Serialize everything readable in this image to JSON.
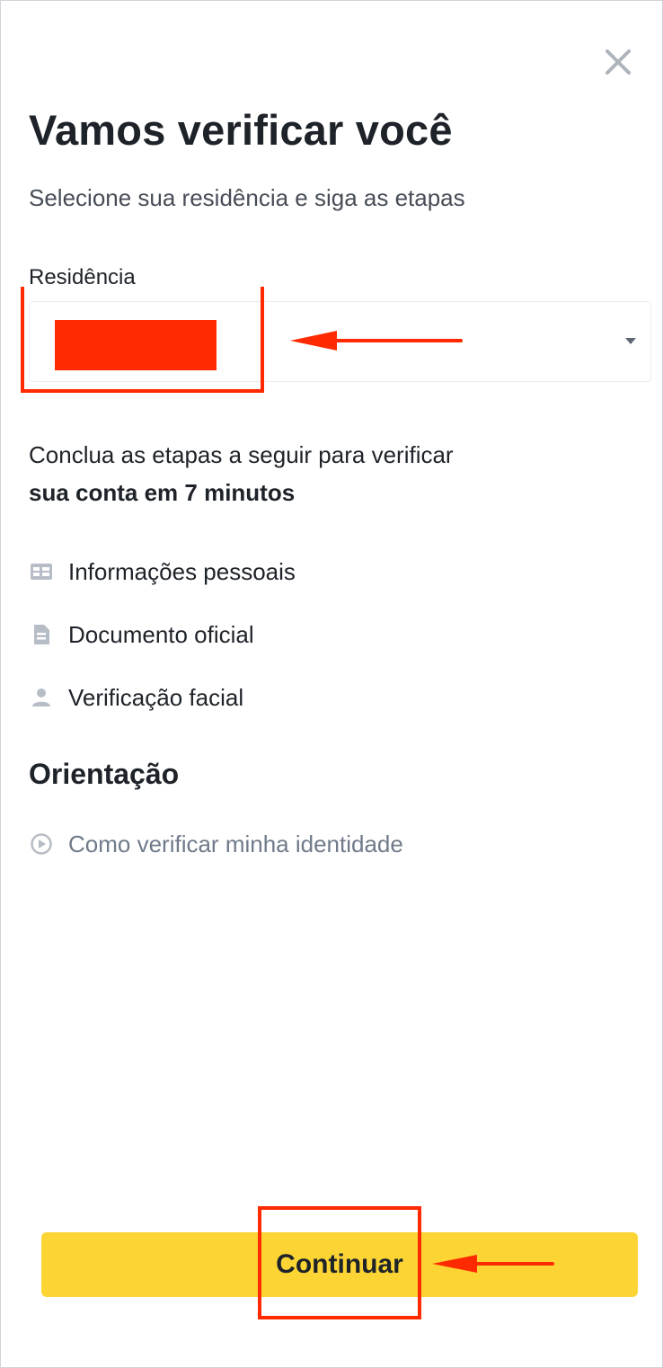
{
  "modal": {
    "title": "Vamos verificar você",
    "subtitle": "Selecione sua residência e siga as etapas",
    "close_icon": "close-icon"
  },
  "residence": {
    "label": "Residência",
    "selected_value": "",
    "caret_icon": "caret-down-icon"
  },
  "steps": {
    "intro_line1": "Conclua as etapas a seguir para verificar",
    "intro_line2": "sua conta em 7 minutos",
    "items": [
      {
        "label": "Informações pessoais",
        "icon": "id-card-icon"
      },
      {
        "label": "Documento oficial",
        "icon": "document-icon"
      },
      {
        "label": "Verificação facial",
        "icon": "person-icon"
      }
    ]
  },
  "guidance": {
    "title": "Orientação",
    "link_label": "Como verificar minha identidade",
    "link_icon": "play-circle-icon"
  },
  "footer": {
    "continue_label": "Continuar"
  },
  "colors": {
    "accent": "#fcd535",
    "text_primary": "#1e2329",
    "text_secondary": "#474d57",
    "text_muted": "#707a8a",
    "icon": "#b7bdc6",
    "annotation": "#ff2a00"
  }
}
